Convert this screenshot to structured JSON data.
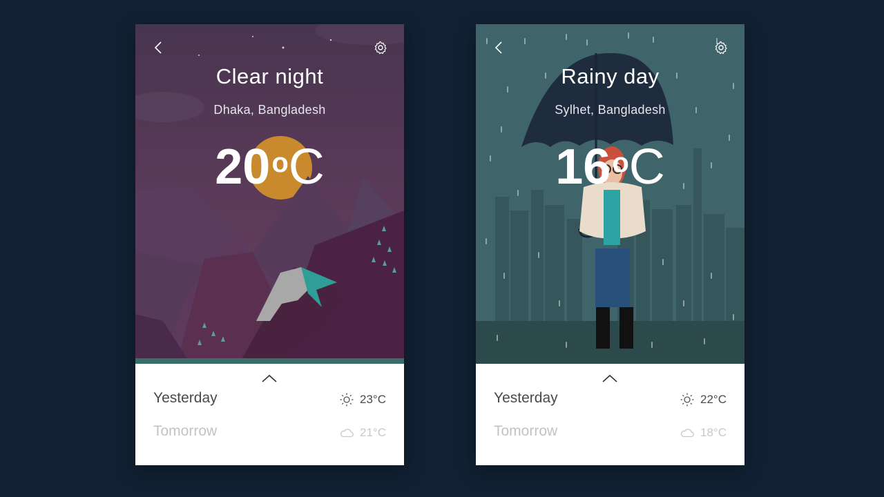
{
  "cards": [
    {
      "title": "Clear night",
      "location": "Dhaka, Bangladesh",
      "temp_value": "20",
      "temp_degree": "o",
      "temp_unit": "C",
      "yesterday_label": "Yesterday",
      "yesterday_temp": "23°C",
      "yesterday_icon": "sun-icon",
      "tomorrow_label": "Tomorrow",
      "tomorrow_temp": "21°C",
      "tomorrow_icon": "cloud-icon"
    },
    {
      "title": "Rainy day",
      "location": "Sylhet, Bangladesh",
      "temp_value": "16",
      "temp_degree": "o",
      "temp_unit": "C",
      "yesterday_label": "Yesterday",
      "yesterday_temp": "22°C",
      "yesterday_icon": "sun-icon",
      "tomorrow_label": "Tomorrow",
      "tomorrow_temp": "18°C",
      "tomorrow_icon": "cloud-icon"
    }
  ],
  "colors": {
    "page_background": "#112133",
    "night_sky": "#4e3553",
    "rain_sky": "#3f6469",
    "moon": "#c98a2e",
    "panel": "#ffffff"
  }
}
